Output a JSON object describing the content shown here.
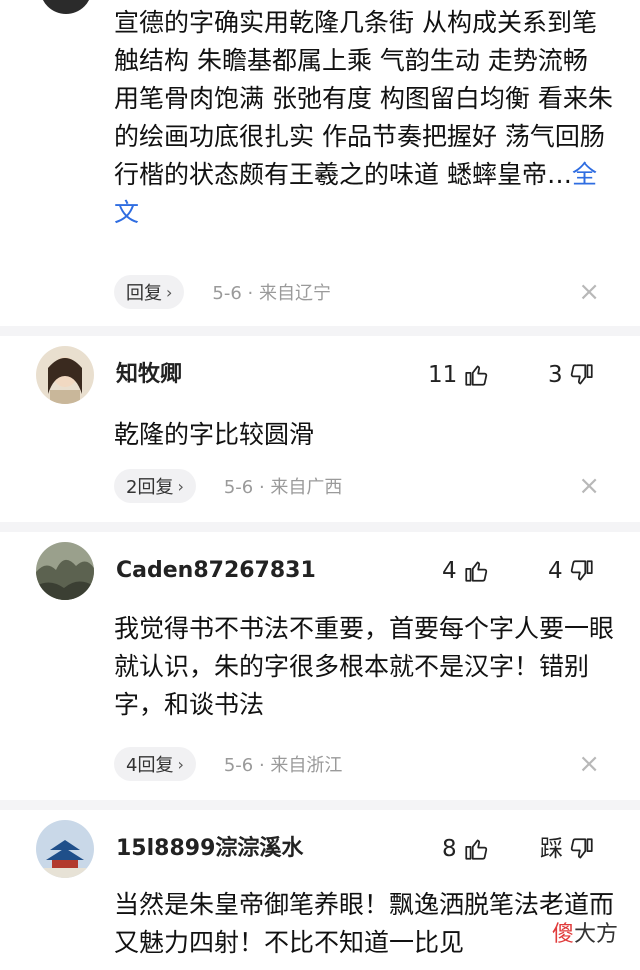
{
  "comments": [
    {
      "text": "宣德的字确实用乾隆几条街 从构成关系到笔触结构 朱瞻基都属上乘 气韵生动 走势流畅 用笔骨肉饱满 张弛有度 构图留白均衡 看来朱的绘画功底很扎实 作品节奏把握好 荡气回肠 行楷的状态颇有王羲之的味道 蟋蟀皇帝…",
      "more": "全文",
      "reply_label": "回复",
      "meta": "5-6 · 来自辽宁"
    },
    {
      "username": "知牧卿",
      "likes": "11",
      "dislikes": "3",
      "text": "乾隆的字比较圆滑",
      "reply_label": "2回复",
      "meta": "5-6 · 来自广西"
    },
    {
      "username": "Caden87267831",
      "likes": "4",
      "dislikes": "4",
      "text": "我觉得书不书法不重要，首要每个字人要一眼就认识，朱的字很多根本就不是汉字！错别字，和谈书法",
      "reply_label": "4回复",
      "meta": "5-6 · 来自浙江"
    },
    {
      "username": "15l8899淙淙溪水",
      "likes": "8",
      "dislikes": "踩",
      "text": "当然是朱皇帝御笔养眼！飘逸洒脱笔法老道而又魅力四射！不比不知道一比见"
    }
  ],
  "watermark": {
    "part1": "傻",
    "part2": "大方"
  },
  "icons": {
    "like": "thumbs-up-icon",
    "dislike": "thumbs-down-icon",
    "close": "close-icon",
    "chevron": "chevron-right-icon"
  }
}
